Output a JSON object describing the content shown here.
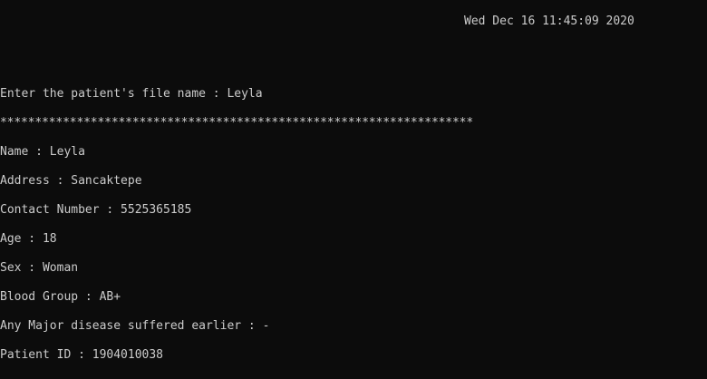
{
  "console": {
    "timestamp": "Wed Dec 16 11:45:09 2020",
    "prompt_label": "Enter the patient's file name : ",
    "prompt_value": "Leyla",
    "separator": "********************************************************************",
    "fields": [
      "Name : Leyla",
      "Address : Sancaktepe",
      "Contact Number : 5525365185",
      "Age : 18",
      "Sex : Woman",
      "Blood Group : AB+",
      "Any Major disease suffered earlier : -",
      "Patient ID : 1904010038"
    ]
  }
}
